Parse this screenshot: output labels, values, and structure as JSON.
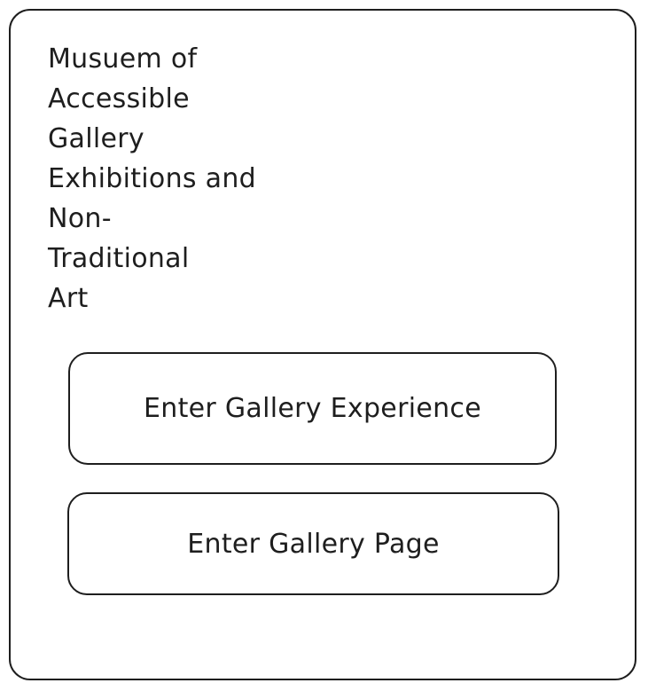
{
  "title_lines": [
    "Musuem of",
    "Accessible",
    "Gallery",
    "Exhibitions and",
    "Non-",
    "Traditional",
    "Art"
  ],
  "buttons": {
    "experience_label": "Enter Gallery Experience",
    "page_label": "Enter Gallery Page"
  },
  "colors": {
    "stroke": "#1e1e1e",
    "background": "#ffffff"
  }
}
